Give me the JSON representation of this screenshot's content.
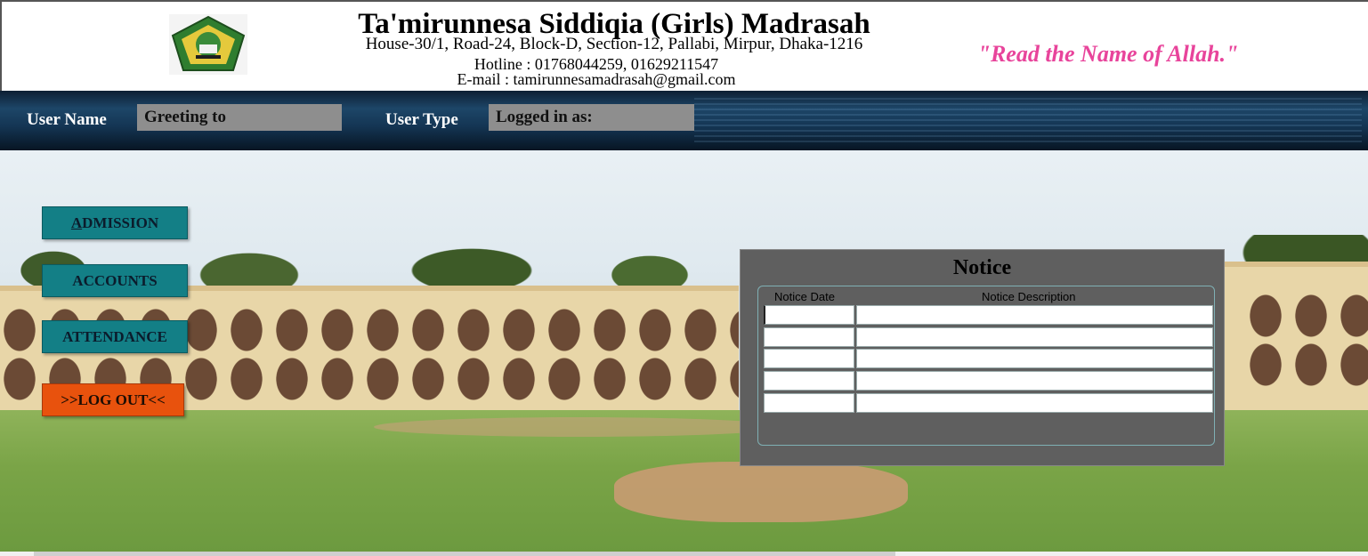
{
  "header": {
    "school_name": "Ta'mirunnesa Siddiqia (Girls) Madrasah",
    "address": "House-30/1, Road-24, Block-D, Section-12, Pallabi, Mirpur, Dhaka-1216",
    "hotline": "Hotline : 01768044259, 01629211547",
    "email": "E-mail : tamirunnesamadrasah@gmail.com",
    "motto": "\"Read the Name of Allah.\""
  },
  "userbar": {
    "user_name_label": "User Name",
    "user_name_value": "Greeting to",
    "user_type_label": "User Type",
    "user_type_value": "Logged in as:"
  },
  "menu": {
    "admission_first": "A",
    "admission_rest": "DMISSION",
    "accounts": "ACCOUNTS",
    "attendance": "ATTENDANCE",
    "logout": ">>LOG OUT<<"
  },
  "notice": {
    "title": "Notice",
    "col_date": "Notice Date",
    "col_desc": "Notice Description"
  },
  "colors": {
    "menu_button": "#137f86",
    "logout_button": "#e8520d",
    "motto": "#e8449b",
    "notice_panel": "#5f5f5f"
  }
}
